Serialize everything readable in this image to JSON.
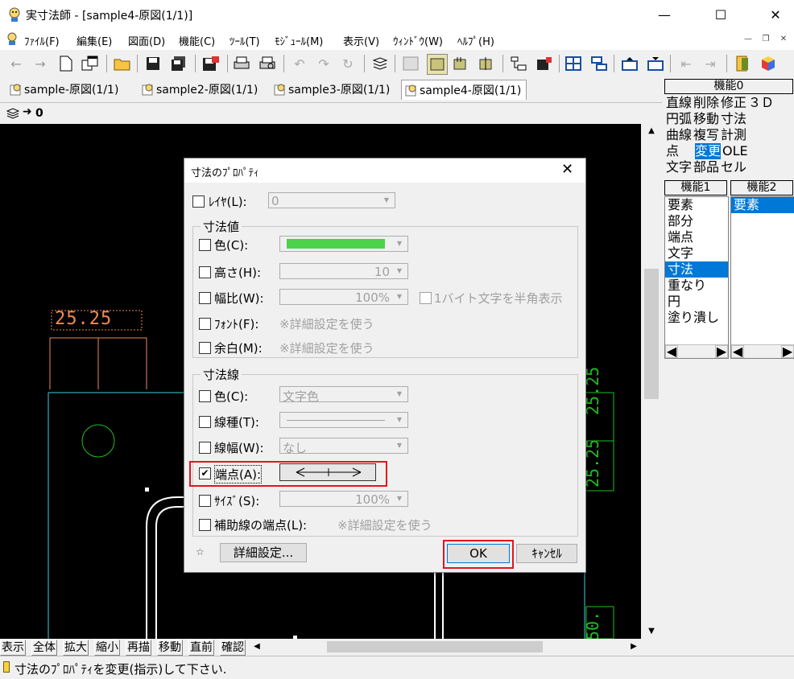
{
  "window": {
    "title": "実寸法師 - [sample4-原図(1/1)]"
  },
  "menu": [
    "ﾌｧｲﾙ(F)",
    "編集(E)",
    "図面(D)",
    "機能(C)",
    "ﾂｰﾙ(T)",
    "ﾓｼﾞｭｰﾙ(M)",
    "表示(V)",
    "ｳｨﾝﾄﾞｳ(W)",
    "ﾍﾙﾌﾟ(H)"
  ],
  "tabs": [
    "sample-原図(1/1)",
    "sample2-原図(1/1)",
    "sample3-原図(1/1)",
    "sample4-原図(1/1)"
  ],
  "layer": {
    "value": "0"
  },
  "canvas": {
    "dim_text_1": "25.25",
    "dim_text_2": "25.25",
    "dim_text_3": "25.25",
    "dim_text_4": "50."
  },
  "functions0": {
    "header": "機能0",
    "rows": [
      [
        "直線",
        "削除",
        "修正",
        "３Ｄ"
      ],
      [
        "円弧",
        "移動",
        "寸法",
        ""
      ],
      [
        "曲線",
        "複写",
        "計測",
        ""
      ],
      [
        "点",
        "変更",
        "OLE",
        ""
      ],
      [
        "文字",
        "部品",
        "セル",
        ""
      ]
    ],
    "selected": "変更"
  },
  "functions1": {
    "header": "機能1",
    "items": [
      "要素",
      "部分",
      "端点",
      "文字",
      "寸法",
      "重なり",
      "円",
      "塗り潰し"
    ],
    "selected": "寸法"
  },
  "functions2": {
    "header": "機能2",
    "items": [
      "要素"
    ],
    "selected": "要素"
  },
  "bottom_buttons": [
    "表示",
    "全体",
    "拡大",
    "縮小",
    "再描",
    "移動",
    "直前",
    "確認"
  ],
  "status": {
    "message": "寸法のﾌﾟﾛﾊﾟﾃｨを変更(指示)して下さい."
  },
  "dialog": {
    "title": "寸法のﾌﾟﾛﾊﾟﾃｨ",
    "layer_label": "ﾚｲﾔ(L):",
    "layer_value": "0",
    "group_value": "寸法値",
    "color_label": "色(C):",
    "height_label": "高さ(H):",
    "height_value": "10",
    "width_ratio_label": "幅比(W):",
    "width_ratio_value": "100%",
    "halfwidth_label": "1バイト文字を半角表示",
    "font_label": "ﾌｫﾝﾄ(F):",
    "font_value": "※詳細設定を使う",
    "margin_label": "余白(M):",
    "margin_value": "※詳細設定を使う",
    "group_line": "寸法線",
    "line_color_label": "色(C):",
    "line_color_value": "文字色",
    "line_type_label": "線種(T):",
    "line_width_label": "線幅(W):",
    "line_width_value": "なし",
    "endpoint_label": "端点(A):",
    "size_label": "ｻｲｽﾞ(S):",
    "size_value": "100%",
    "aux_endpoint_label": "補助線の端点(L):",
    "aux_endpoint_value": "※詳細設定を使う",
    "detail_button": "詳細設定...",
    "ok_button": "OK",
    "cancel_button": "ｷｬﾝｾﾙ",
    "endpoint_checked": true,
    "swatch_color": "#4cd24c"
  },
  "colors": {
    "highlight": "#e3141e",
    "selection": "#0078d7",
    "dim_orange": "#f08a50",
    "cyan": "#40d0e0",
    "green": "#20c020"
  }
}
